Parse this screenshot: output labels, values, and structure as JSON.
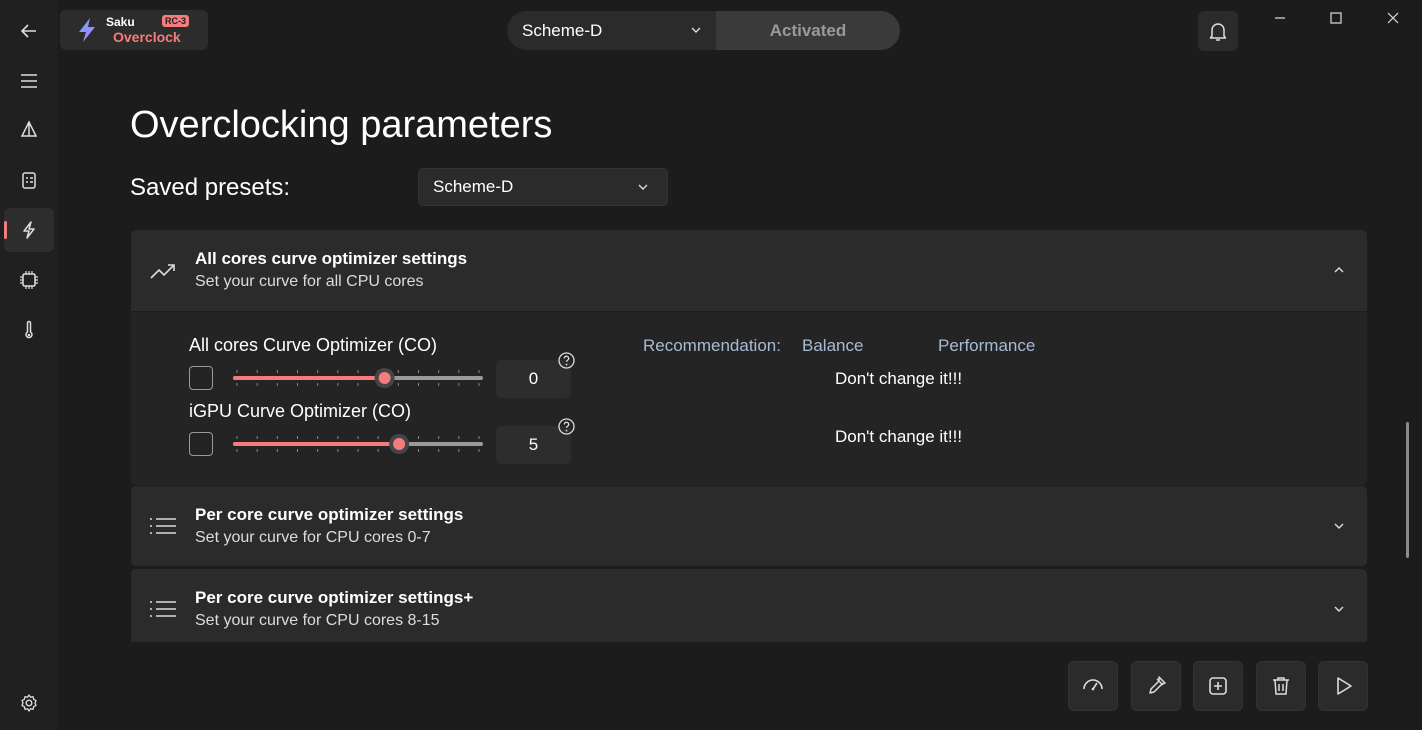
{
  "logo": {
    "line1": "Saku",
    "line2": "Overclock",
    "badge": "RC-3"
  },
  "topbar": {
    "scheme_selected": "Scheme-D",
    "activated_label": "Activated"
  },
  "page": {
    "title": "Overclocking parameters",
    "presets_label": "Saved presets:",
    "preset_selected": "Scheme-D"
  },
  "cards": [
    {
      "title": "All cores curve optimizer settings",
      "subtitle": "Set your curve for all CPU cores",
      "expanded": true
    },
    {
      "title": "Per core curve optimizer settings",
      "subtitle": "Set your curve for CPU cores 0-7",
      "expanded": false
    },
    {
      "title": "Per core curve optimizer settings+",
      "subtitle": "Set your curve for CPU cores 8-15",
      "expanded": false
    }
  ],
  "options": [
    {
      "label": "All cores Curve Optimizer (CO)",
      "value": "0",
      "slider_fraction": 0.61,
      "note": "Don't change it!!!"
    },
    {
      "label": "iGPU Curve Optimizer (CO)",
      "value": "5",
      "slider_fraction": 0.67,
      "note": "Don't change it!!!"
    }
  ],
  "recommendation": {
    "label": "Recommendation:",
    "balance": "Balance",
    "performance": "Performance"
  },
  "colors": {
    "accent": "#f47c7c",
    "background": "#1c1c1c",
    "card": "#2b2b2b",
    "recommend_text": "#a8bbd4"
  },
  "icons": [
    "back-arrow-icon",
    "hamburger-icon",
    "sail-icon",
    "clipboard-icon",
    "bolt-icon",
    "chip-icon",
    "thermometer-icon",
    "gear-icon",
    "bell-icon",
    "chart-trend-icon",
    "list-icon",
    "gauge-icon",
    "eyedropper-icon",
    "add-preset-icon",
    "trash-icon",
    "play-icon"
  ]
}
